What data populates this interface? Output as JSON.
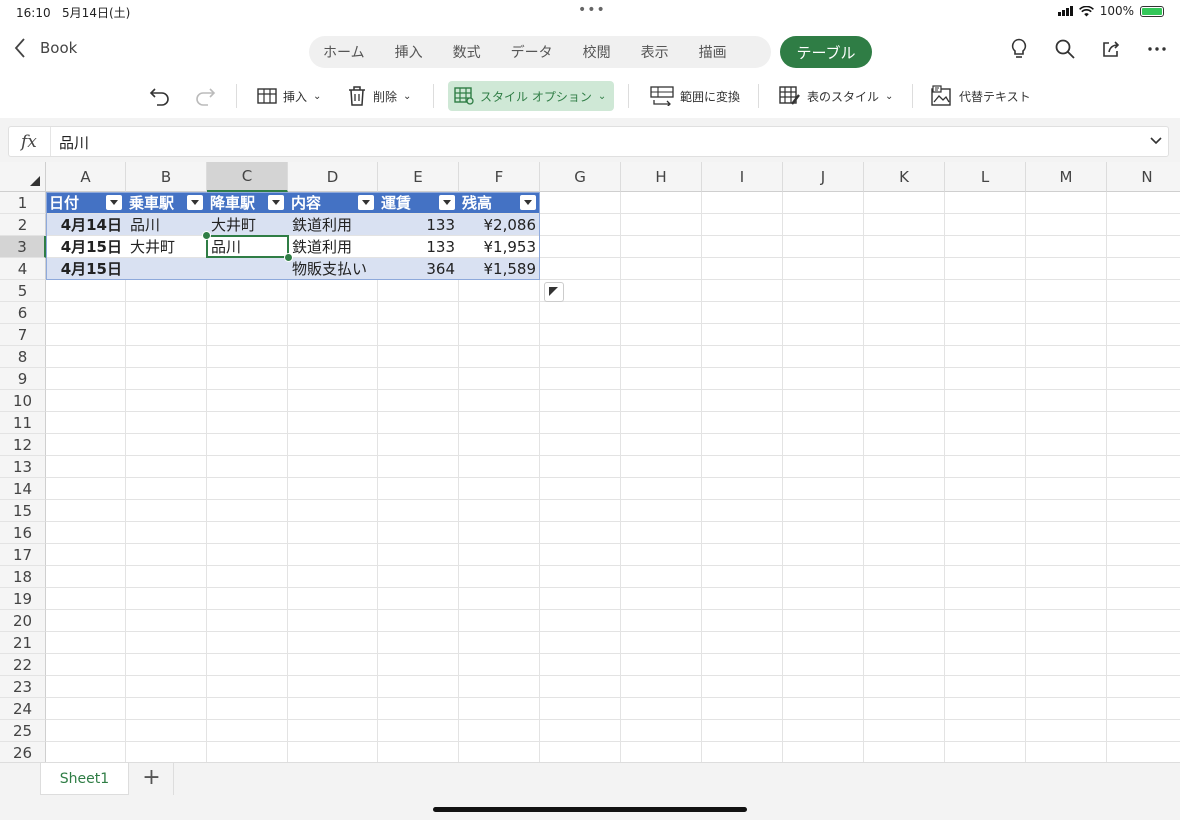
{
  "status": {
    "time": "16:10",
    "date": "5月14日(土)",
    "battery": "100%",
    "dots": "•••"
  },
  "topbar": {
    "back_label": "Book",
    "tabs": [
      "ホーム",
      "挿入",
      "数式",
      "データ",
      "校閲",
      "表示",
      "描画"
    ],
    "active_tab": "テーブル"
  },
  "ribbon": {
    "insert": "挿入",
    "delete": "削除",
    "style_options": "スタイル オプション",
    "convert_to_range": "範囲に変換",
    "table_styles": "表のスタイル",
    "alt_text": "代替テキスト"
  },
  "formula_bar": {
    "fx": "fx",
    "value": "品川"
  },
  "columns": [
    "A",
    "B",
    "C",
    "D",
    "E",
    "F",
    "G",
    "H",
    "I",
    "J",
    "K",
    "L",
    "M",
    "N"
  ],
  "rows": [
    "1",
    "2",
    "3",
    "4",
    "5",
    "6",
    "7",
    "8",
    "9",
    "10",
    "11",
    "12",
    "13",
    "14",
    "15",
    "16",
    "17",
    "18",
    "19",
    "20",
    "21",
    "22",
    "23",
    "24",
    "25",
    "26"
  ],
  "selected_cell": "C3",
  "table": {
    "headers": [
      "日付",
      "乗車駅",
      "降車駅",
      "内容",
      "運賃",
      "残高"
    ],
    "rows": [
      [
        "4月14日",
        "品川",
        "大井町",
        "鉄道利用",
        "133",
        "¥2,086"
      ],
      [
        "4月15日",
        "大井町",
        "品川",
        "鉄道利用",
        "133",
        "¥1,953"
      ],
      [
        "4月15日",
        "",
        "",
        "物販支払い",
        "364",
        "¥1,589"
      ]
    ],
    "header_color": "#4472c4",
    "band_color": "#d9e1f2"
  },
  "sheets": {
    "active": "Sheet1",
    "add": "+"
  }
}
